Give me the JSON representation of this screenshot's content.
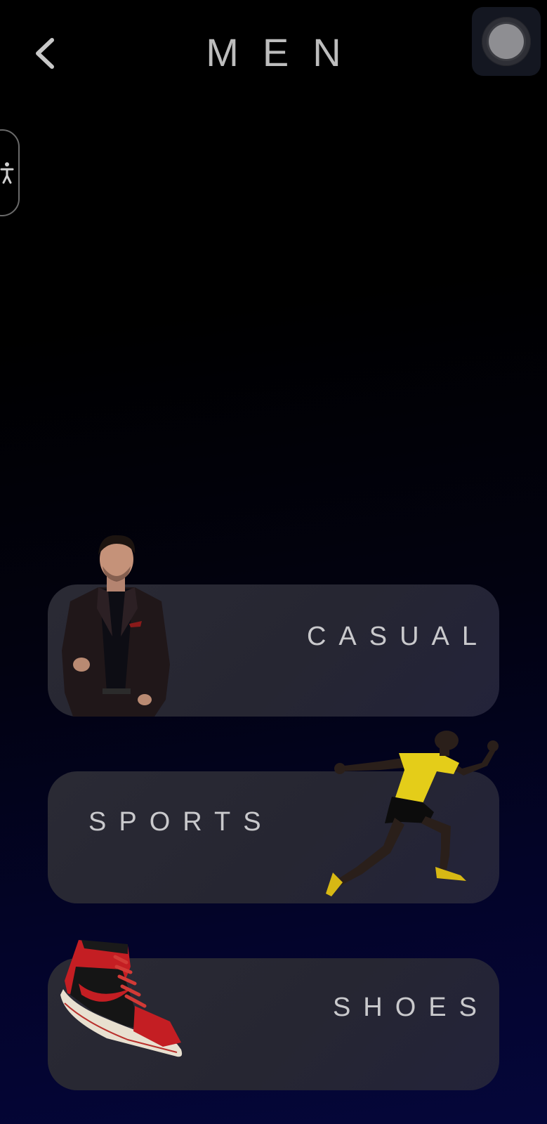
{
  "header": {
    "title": "MEN",
    "back_icon": "chevron-left-icon"
  },
  "accessibility_tab": {
    "icon": "accessibility-icon"
  },
  "assistive_button": {
    "icon": "assistive-touch-icon"
  },
  "categories": [
    {
      "label": "CASUAL",
      "image": "man-in-suit-image"
    },
    {
      "label": "SPORTS",
      "image": "sprinter-image"
    },
    {
      "label": "SHOES",
      "image": "sneaker-image"
    }
  ],
  "colors": {
    "background_top": "#000000",
    "background_bottom": "#05063a",
    "card": "#272731",
    "text": "#c9c9cc"
  }
}
